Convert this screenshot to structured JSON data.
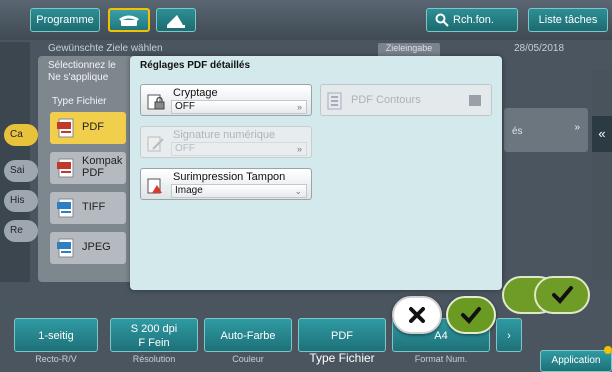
{
  "topbar": {
    "program_label": "Programme",
    "search_label": "Rch.fon.",
    "jobs_label": "Liste tâches"
  },
  "background": {
    "header_text": "Gewünschte Ziele wählen",
    "dest_label": "Zieleingabe",
    "date": "28/05/2018",
    "side_left": [
      "Ca",
      "Sai",
      "His",
      "Re"
    ],
    "right_label": "és"
  },
  "type_popup": {
    "line1": "Sélectionnez le",
    "line2": "Ne s'applique",
    "title": "Type Fichier",
    "types": [
      {
        "label": "PDF",
        "icon": "pdf-file-icon"
      },
      {
        "label": "Kompak\nPDF",
        "label1": "Kompak",
        "label2": "PDF",
        "icon": "compact-pdf-file-icon"
      },
      {
        "label": "TIFF",
        "icon": "tiff-file-icon"
      },
      {
        "label": "JPEG",
        "icon": "jpeg-file-icon"
      }
    ]
  },
  "dialog": {
    "title": "Réglages PDF détaillés",
    "encryption": {
      "label": "Cryptage",
      "value": "OFF"
    },
    "signature": {
      "label": "Signature numérique",
      "value": "OFF"
    },
    "stamp": {
      "label": "Surimpression Tampon",
      "value": "Image"
    },
    "outlines": {
      "label": "PDF Contours"
    }
  },
  "bottom": {
    "buttons": [
      {
        "label": "1-seitig"
      },
      {
        "label": "S 200 dpi",
        "label2": "F Fein"
      },
      {
        "label": "Auto-Farbe"
      },
      {
        "label": "PDF"
      },
      {
        "label": "A4"
      }
    ],
    "labels": [
      "Recto-R/V",
      "Résolution",
      "Couleur",
      "Type Fichier",
      "Format Num."
    ],
    "app_label": "Application"
  },
  "colors": {
    "accent_teal": "#1e7179",
    "highlight_yellow": "#f1cf4c",
    "ok_green": "#6a9a22"
  }
}
